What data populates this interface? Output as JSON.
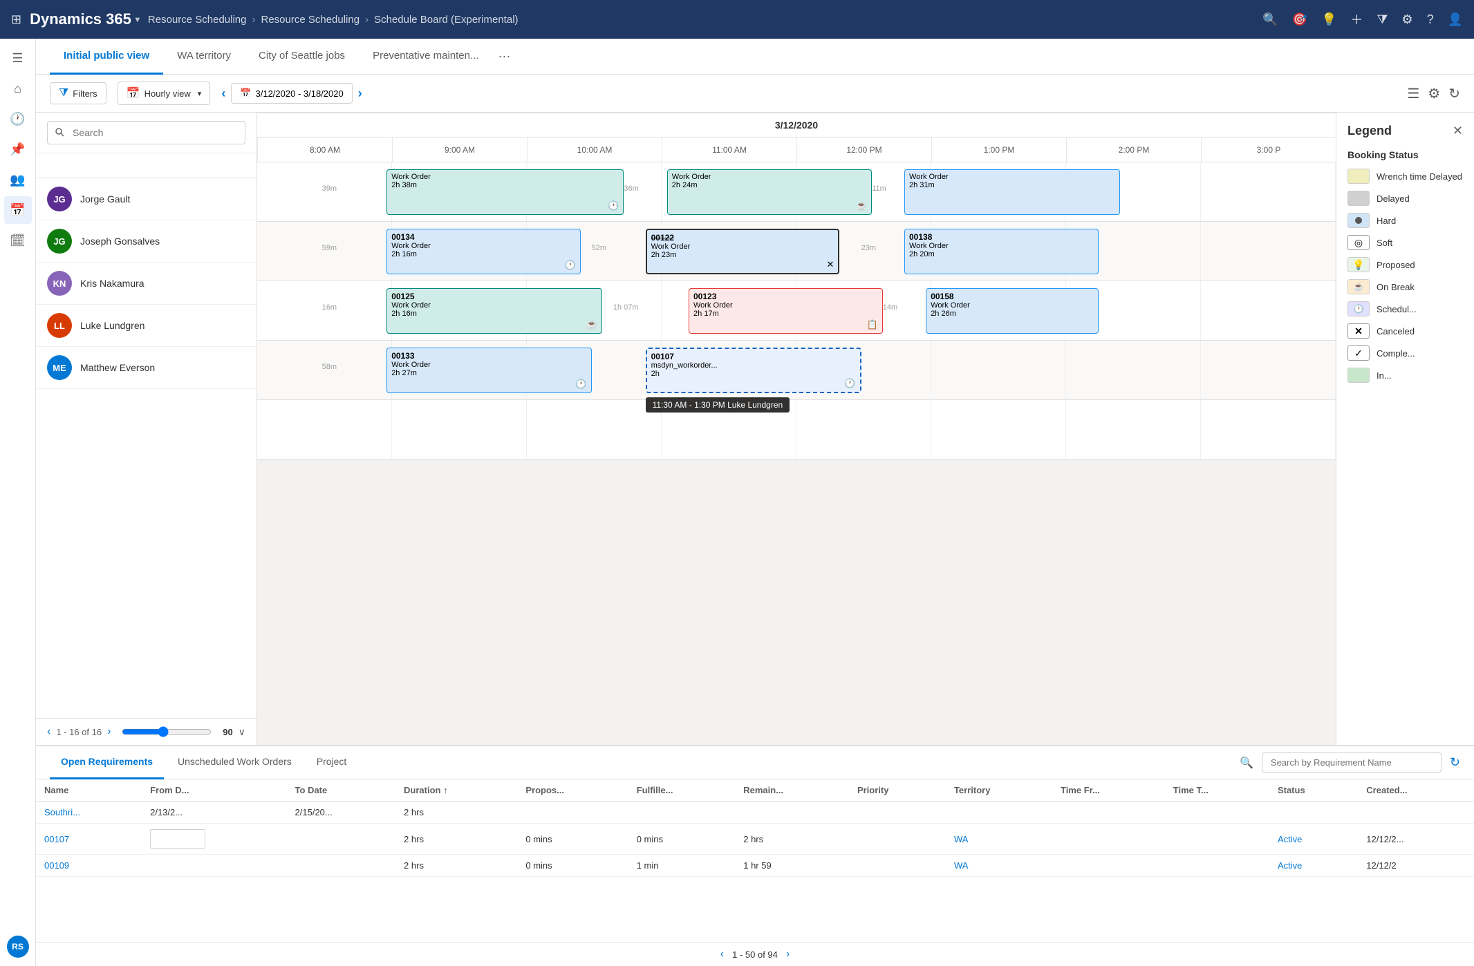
{
  "app": {
    "title": "Dynamics 365",
    "breadcrumb": [
      "Resource Scheduling",
      "Resource Scheduling",
      "Schedule Board (Experimental)"
    ]
  },
  "tabs": [
    {
      "label": "Initial public view",
      "active": true
    },
    {
      "label": "WA territory",
      "active": false
    },
    {
      "label": "City of Seattle jobs",
      "active": false
    },
    {
      "label": "Preventative mainten...",
      "active": false
    }
  ],
  "toolbar": {
    "filters_label": "Filters",
    "hourly_view_label": "Hourly view",
    "date_range": "3/12/2020 - 3/18/2020",
    "date_header": "3/12/2020"
  },
  "time_slots": [
    "8:00 AM",
    "9:00 AM",
    "10:00 AM",
    "11:00 AM",
    "12:00 PM",
    "1:00 PM",
    "2:00 PM",
    "3:00 P"
  ],
  "resources": [
    {
      "name": "Jorge Gault",
      "initials": "JG",
      "color": "#0078d4"
    },
    {
      "name": "Joseph Gonsalves",
      "initials": "JG2",
      "color": "#107c10"
    },
    {
      "name": "Kris Nakamura",
      "initials": "KN",
      "color": "#8764b8",
      "has_photo": true
    },
    {
      "name": "Luke Lundgren",
      "initials": "LL",
      "color": "#d83b01"
    },
    {
      "name": "Matthew Everson",
      "initials": "ME",
      "color": "#0078d4",
      "has_photo": true
    }
  ],
  "pagination": {
    "text": "1 - 16 of 16",
    "slider_value": 90
  },
  "legend": {
    "title": "Legend",
    "section": "Booking Status",
    "items": [
      {
        "label": "Wrench time Delayed",
        "swatch": "wrench"
      },
      {
        "label": "Delayed",
        "swatch": "delayed"
      },
      {
        "label": "Hard",
        "swatch": "hard"
      },
      {
        "label": "Soft",
        "swatch": "soft"
      },
      {
        "label": "Proposed",
        "swatch": "proposed"
      },
      {
        "label": "On Break",
        "swatch": "onbreak"
      },
      {
        "label": "Schedul...",
        "swatch": "scheduled"
      },
      {
        "label": "Canceled",
        "swatch": "canceled"
      },
      {
        "label": "Comple...",
        "swatch": "completed"
      },
      {
        "label": "In...",
        "swatch": "in"
      }
    ]
  },
  "bottom_tabs": [
    {
      "label": "Open Requirements",
      "active": true
    },
    {
      "label": "Unscheduled Work Orders",
      "active": false
    },
    {
      "label": "Project",
      "active": false
    }
  ],
  "search_placeholder": "Search by Requirement Name",
  "table_headers": [
    "Name",
    "From D...",
    "To Date",
    "Duration ↑",
    "Propos...",
    "Fulfille...",
    "Remain...",
    "Priority",
    "Territory",
    "Time Fr...",
    "Time T...",
    "Status",
    "Created..."
  ],
  "table_rows": [
    {
      "name": "Southri...",
      "name_link": true,
      "from": "2/13/2...",
      "to": "2/15/20...",
      "duration": "2 hrs",
      "proposed": "",
      "fulfilled": "",
      "remaining": "",
      "priority": "",
      "territory": "",
      "time_from": "",
      "time_to": "",
      "status": "",
      "created": ""
    },
    {
      "name": "00107",
      "name_link": true,
      "from": "",
      "to": "",
      "duration": "2 hrs",
      "proposed": "0 mins",
      "fulfilled": "0 mins",
      "remaining": "2 hrs",
      "priority": "",
      "territory": "WA",
      "time_from": "",
      "time_to": "",
      "status": "Active",
      "created": "12/12/2..."
    },
    {
      "name": "00109",
      "name_link": true,
      "from": "",
      "to": "",
      "duration": "2 hrs",
      "proposed": "0 mins",
      "fulfilled": "1 min",
      "remaining": "1 hr 59",
      "priority": "",
      "territory": "WA",
      "time_from": "",
      "time_to": "",
      "status": "Active",
      "created": "12/12/2"
    }
  ],
  "bottom_pagination": {
    "text": "1 - 50 of 94"
  },
  "bookings": {
    "jorge": [
      {
        "title": "Work Order",
        "duration": "2h 38m",
        "left": "31%",
        "width": "22%",
        "color": "teal",
        "icon": "🕐",
        "gap_left": "39m"
      },
      {
        "title": "Work Order",
        "duration": "2h 24m",
        "left": "58%",
        "width": "19%",
        "color": "teal",
        "icon": "☕",
        "gap_left": "36m"
      },
      {
        "title": "Work Order",
        "duration": "2h 31m",
        "left": "80%",
        "width": "18%",
        "color": "blue",
        "icon": "",
        "gap_left": "11m"
      }
    ],
    "joseph": [
      {
        "id": "00134",
        "title": "Work Order",
        "duration": "2h 16m",
        "left": "31%",
        "width": "18%",
        "color": "blue",
        "icon": "🕐",
        "gap_left": "59m"
      },
      {
        "id": "00122",
        "title": "Work Order",
        "duration": "2h 23m",
        "left": "58%",
        "width": "18%",
        "color": "blue",
        "icon": "✕",
        "gap_left": "52m",
        "strikethrough": true
      },
      {
        "id": "00138",
        "title": "Work Order",
        "duration": "2h 20m",
        "left": "80%",
        "width": "17%",
        "color": "blue",
        "icon": "",
        "gap_left": "23m"
      }
    ],
    "kris": [
      {
        "id": "00125",
        "title": "Work Order",
        "duration": "2h 16m",
        "left": "31%",
        "width": "20%",
        "color": "teal",
        "icon": "☕",
        "gap_left": "16m"
      },
      {
        "id": "00123",
        "title": "Work Order",
        "duration": "2h 17m",
        "left": "61%",
        "width": "18%",
        "color": "pink",
        "icon": "📋",
        "gap_left": "1h 07m"
      },
      {
        "id": "00158",
        "title": "Work Order",
        "duration": "2h 26m",
        "left": "82%",
        "width": "16%",
        "color": "blue",
        "icon": "",
        "gap_left": "14m"
      }
    ],
    "luke": [
      {
        "id": "00133",
        "title": "Work Order",
        "duration": "2h 27m",
        "left": "31%",
        "width": "19%",
        "color": "blue",
        "icon": "🕐",
        "gap_left": "58m"
      },
      {
        "id": "00107",
        "title": "msdyn_workorder...",
        "duration": "2h",
        "left": "58%",
        "width": "20%",
        "color": "dashed",
        "icon": "🕐",
        "gap_left": ""
      }
    ]
  },
  "tooltip": "11:30 AM - 1:30 PM Luke Lundgren"
}
